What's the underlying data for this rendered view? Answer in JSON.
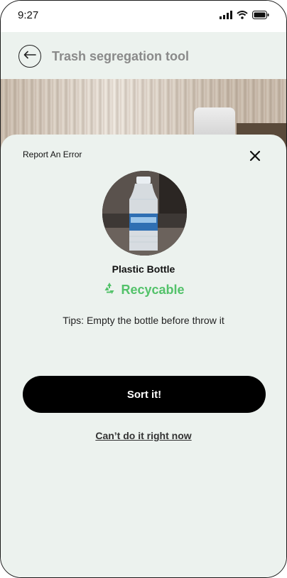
{
  "status_bar": {
    "time": "9:27",
    "icons": [
      "signal-icon",
      "wifi-icon",
      "battery-icon"
    ]
  },
  "header": {
    "back_icon": "arrow-left-icon",
    "title": "Trash segregation tool"
  },
  "sheet": {
    "report_label": "Report  An Error",
    "close_icon": "close-icon",
    "item_name": "Plastic Bottle",
    "category_icon": "recycle-icon",
    "category_label": "Recycable",
    "tip": "Tips: Empty the bottle before throw it",
    "primary_button": "Sort it!",
    "secondary_link": "Can’t do it right now"
  },
  "colors": {
    "sheet_background": "#ecf2ee",
    "recyclable_green": "#53c26a",
    "primary_button": "#000000",
    "header_title": "#8a8a8a"
  }
}
